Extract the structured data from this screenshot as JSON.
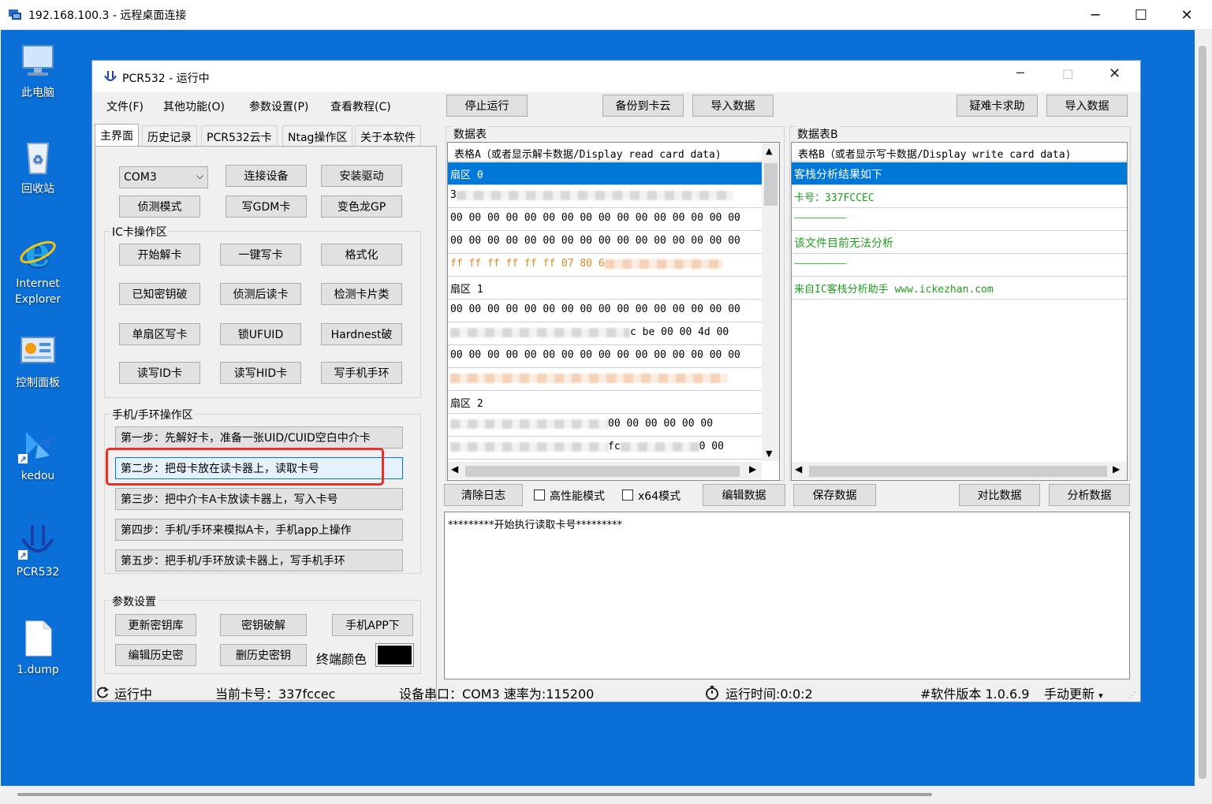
{
  "rdp": {
    "title": "192.168.100.3 - 远程桌面连接"
  },
  "desktop": {
    "icons": [
      {
        "label": "此电脑"
      },
      {
        "label": "回收站"
      },
      {
        "label": "Internet Explorer"
      },
      {
        "label": "控制面板"
      },
      {
        "label": "kedou"
      },
      {
        "label": "PCR532"
      },
      {
        "label": "1.dump"
      }
    ]
  },
  "app": {
    "title": "PCR532 - 运行中",
    "menu": [
      "文件(F)",
      "其他功能(O)",
      "参数设置(P)",
      "查看教程(C)"
    ],
    "toolbar": {
      "stop": "停止运行",
      "backup": "备份到卡云",
      "import1": "导入数据",
      "help": "疑难卡求助",
      "import2": "导入数据"
    },
    "tabs": [
      "主界面",
      "历史记录",
      "PCR532云卡",
      "Ntag操作区",
      "关于本软件"
    ],
    "top_controls": {
      "com_value": "COM3",
      "connect": "连接设备",
      "install": "安装驱动",
      "detect": "侦测模式",
      "write_gdm": "写GDM卡",
      "chameleon": "变色龙GP"
    },
    "ic_group": {
      "label": "IC卡操作区",
      "buttons": [
        "开始解卡",
        "一键写卡",
        "格式化",
        "已知密钥破",
        "侦测后读卡",
        "检测卡片类",
        "单扇区写卡",
        "锁UFUID",
        "Hardnest破",
        "读写ID卡",
        "读写HID卡",
        "写手机手环"
      ]
    },
    "phone_group": {
      "label": "手机/手环操作区",
      "steps": [
        "第一步：先解好卡，准备一张UID/CUID空白中介卡",
        "第二步：把母卡放在读卡器上，读取卡号",
        "第三步：把中介卡A卡放读卡器上，写入卡号",
        "第四步：手机/手环来模拟A卡，手机app上操作",
        "第五步：把手机/手环放读卡器上，写手机手环"
      ]
    },
    "param_group": {
      "label": "参数设置",
      "update_keys": "更新密钥库",
      "key_crack": "密钥破解",
      "phone_app": "手机APP下",
      "edit_history": "编辑历史密",
      "delete_history": "删历史密钥",
      "terminal_color_label": "终端颜色"
    },
    "table_a": {
      "title": "数据表",
      "header": "表格A（或者显示解卡数据/Display read card data)",
      "rows": [
        "扇区 0",
        "3",
        "00 00 00 00 00 00 00 00 00 00 00 00 00 00 00 00",
        "00 00 00 00 00 00 00 00 00 00 00 00 00 00 00 00",
        "ff ff ff ff ff ff 07 80 6",
        "扇区 1",
        "00 00 00 00 00 00 00 00 00 00 00 00 00 00 00 00",
        "c be 00 00 4d 00",
        "00 00 00 00 00 00 00 00 00 00 00 00 00 00 00 00",
        "",
        "扇区 2",
        "00 00 00 00 00 00",
        "fc",
        "0 00"
      ]
    },
    "table_b": {
      "title": "数据表B",
      "header": "表格B（或者显示写卡数据/Display write card data)",
      "rows": [
        "客栈分析结果如下",
        "卡号：337FCCEC",
        "——————————————",
        "该文件目前无法分析",
        "——————————————",
        "来自IC客栈分析助手 www.ickezhan.com"
      ]
    },
    "bottom_controls": {
      "clear_log": "清除日志",
      "high_perf": "高性能模式",
      "x64": "x64模式",
      "edit_data": "编辑数据",
      "save_data": "保存数据",
      "compare_data": "对比数据",
      "analyze_data": "分析数据"
    },
    "log_text": "*********开始执行读取卡号*********",
    "status": {
      "running": "运行中",
      "card_no": "当前卡号：337fccec",
      "port": "设备串口：COM3 速率为:115200",
      "runtime": "运行时间:0:0:2",
      "version": "#软件版本 1.0.6.9",
      "update": "手动更新"
    }
  }
}
